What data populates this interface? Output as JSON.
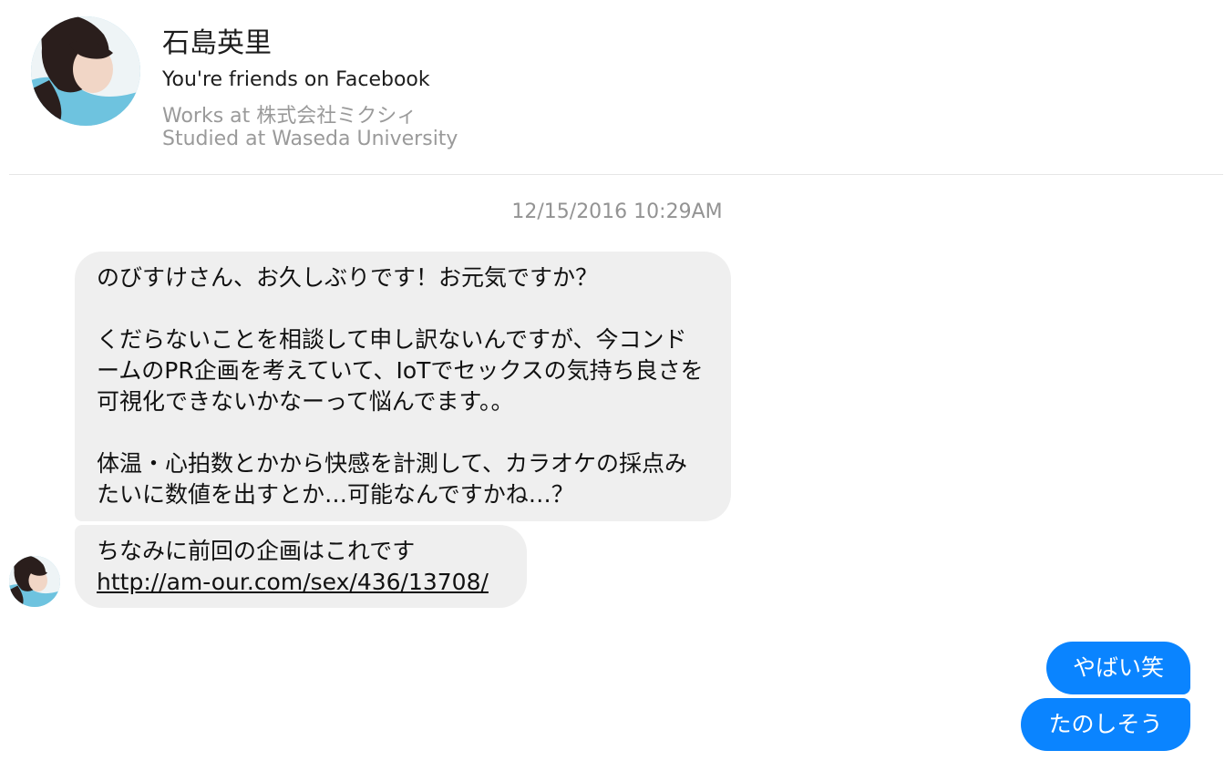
{
  "profile": {
    "name": "石島英里",
    "friends_status": "You're friends on Facebook",
    "work": "Works at 株式会社ミクシィ",
    "education": "Studied at Waseda University"
  },
  "conversation": {
    "timestamp": "12/15/2016 10:29AM",
    "incoming": [
      {
        "text": "のびすけさん、お久しぶりです！お元気ですか？\n\nくだらないことを相談して申し訳ないんですが、今コンドームのPR企画を考えていて、IoTでセックスの気持ち良さを可視化できないかなーって悩んでます。。\n\n体温・心拍数とかから快感を計測して、カラオケの採点みたいに数値を出すとか…可能なんですかね…？"
      },
      {
        "text": "ちなみに前回の企画はこれです",
        "link": "http://am-our.com/sex/436/13708/"
      }
    ],
    "outgoing": [
      {
        "text": "やばい笑"
      },
      {
        "text": "たのしそう"
      }
    ]
  },
  "colors": {
    "incoming_bubble": "#efefef",
    "outgoing_bubble": "#0a84ff",
    "secondary_text": "#9a9a9a"
  }
}
